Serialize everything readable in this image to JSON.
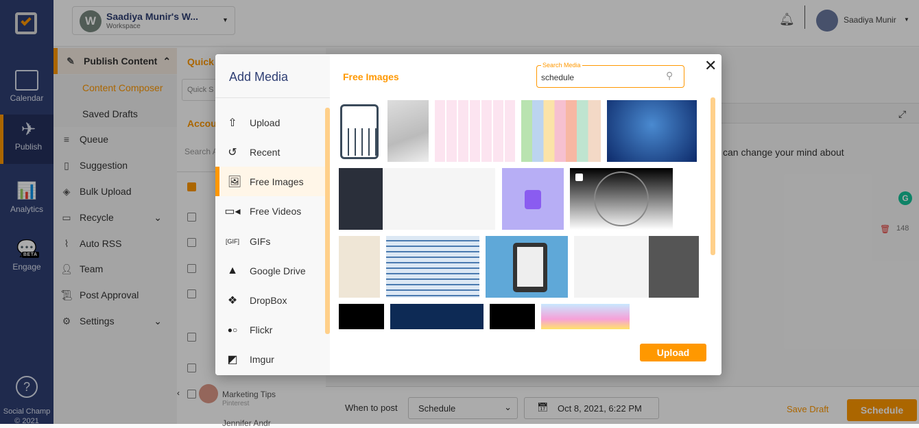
{
  "sidebar": {
    "items": [
      {
        "label": "Calendar"
      },
      {
        "label": "Publish"
      },
      {
        "label": "Analytics"
      },
      {
        "label": "Engage",
        "badge": "BETA"
      }
    ],
    "footer": "Social Champ",
    "copyright": "© 2021"
  },
  "topbar": {
    "workspace_initial": "W",
    "workspace_name": "Saadiya Munir's W...",
    "workspace_sub": "Workspace",
    "user_name": "Saadiya Munir"
  },
  "nav": {
    "header": "Publish Content",
    "sub": [
      "Content Composer",
      "Saved Drafts"
    ],
    "items": [
      "Queue",
      "Suggestion",
      "Bulk Upload",
      "Recycle",
      "Auto RSS",
      "Team",
      "Post Approval",
      "Settings"
    ]
  },
  "mid": {
    "quick": "Quick",
    "quick_search": "Quick S",
    "accounts": "Accou",
    "search_accounts": "Search A",
    "visible_account": {
      "name": "Marketing Tips",
      "network": "Pinterest"
    },
    "next_account": "Jennifer Andr"
  },
  "main": {
    "post_text": "can change your mind about",
    "char_count": "148"
  },
  "bottom": {
    "when_label": "When to post",
    "when_value": "Schedule",
    "datetime": "Oct 8, 2021, 6:22 PM",
    "save_draft": "Save Draft",
    "schedule": "Schedule"
  },
  "modal": {
    "title": "Add Media",
    "section_title": "Free Images",
    "search_label": "Search Media",
    "search_value": "schedule",
    "upload_button": "Upload",
    "sources": [
      {
        "label": "Upload",
        "icon": "upload-icon"
      },
      {
        "label": "Recent",
        "icon": "history-icon"
      },
      {
        "label": "Free Images",
        "icon": "image-icon",
        "active": true
      },
      {
        "label": "Free Videos",
        "icon": "video-icon"
      },
      {
        "label": "GIFs",
        "icon": "gif-icon"
      },
      {
        "label": "Google Drive",
        "icon": "google-drive-icon"
      },
      {
        "label": "DropBox",
        "icon": "dropbox-icon"
      },
      {
        "label": "Flickr",
        "icon": "flickr-icon"
      },
      {
        "label": "Imgur",
        "icon": "imgur-icon"
      }
    ]
  },
  "colors": {
    "accent": "#ff9800",
    "sidebar": "#2f3f74"
  }
}
